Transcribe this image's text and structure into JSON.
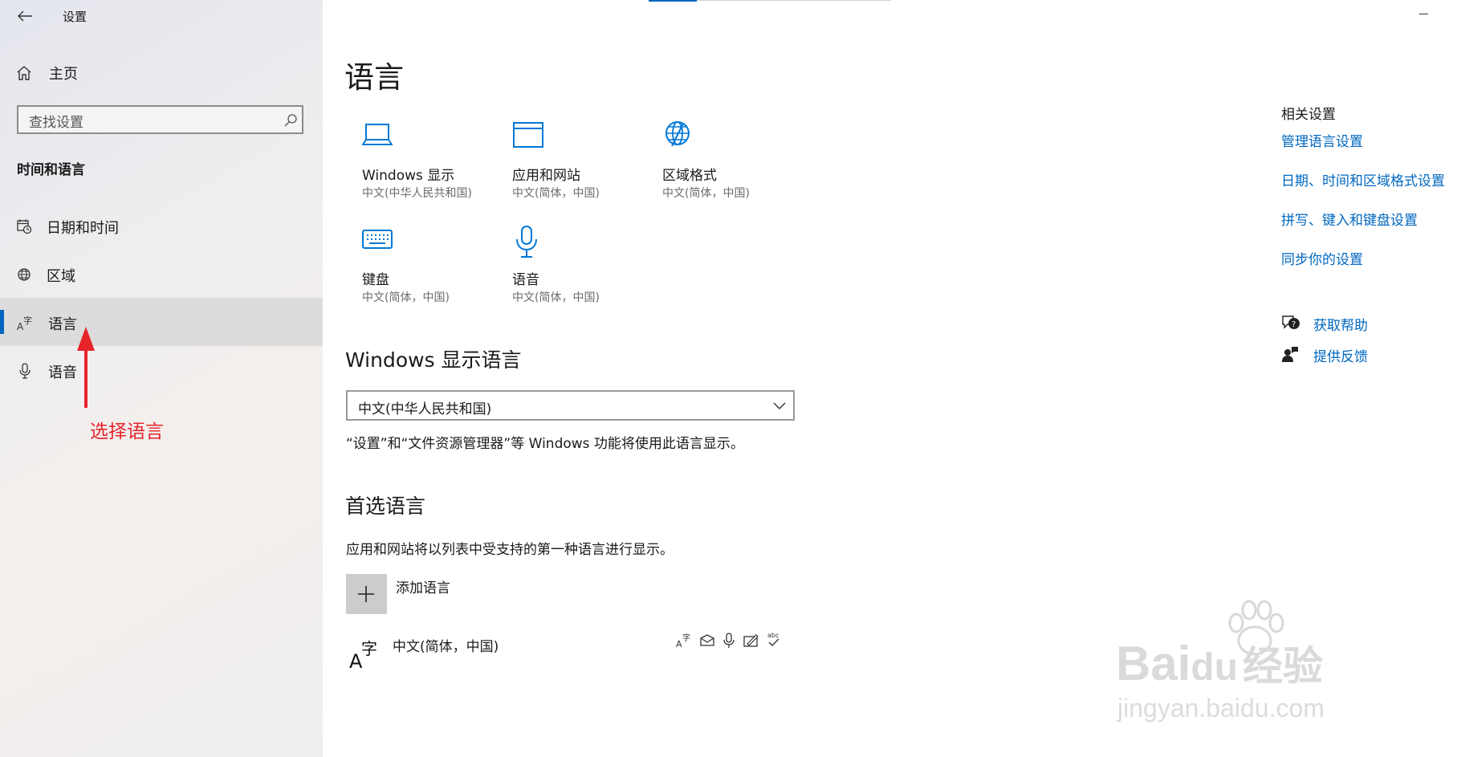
{
  "window": {
    "title": "设置"
  },
  "sidebar": {
    "home_label": "主页",
    "search_placeholder": "查找设置",
    "section_title": "时间和语言",
    "items": [
      {
        "label": "日期和时间",
        "icon": "calendar-clock-icon"
      },
      {
        "label": "区域",
        "icon": "globe-region-icon"
      },
      {
        "label": "语言",
        "icon": "language-icon",
        "selected": true
      },
      {
        "label": "语音",
        "icon": "microphone-icon"
      }
    ]
  },
  "annotation": {
    "text": "选择语言",
    "color": "#e8242b"
  },
  "main": {
    "title": "语言",
    "tiles": [
      {
        "title": "Windows 显示",
        "subtitle": "中文(中华人民共和国)",
        "icon": "laptop-icon"
      },
      {
        "title": "应用和网站",
        "subtitle": "中文(简体，中国)",
        "icon": "browser-window-icon"
      },
      {
        "title": "区域格式",
        "subtitle": "中文(简体，中国)",
        "icon": "globe-format-icon"
      },
      {
        "title": "键盘",
        "subtitle": "中文(简体，中国)",
        "icon": "keyboard-icon"
      },
      {
        "title": "语音",
        "subtitle": "中文(简体，中国)",
        "icon": "microphone-icon"
      }
    ],
    "display_language": {
      "heading": "Windows 显示语言",
      "selected": "中文(中华人民共和国)",
      "description": "“设置”和“文件资源管理器”等 Windows 功能将使用此语言显示。"
    },
    "preferred": {
      "heading": "首选语言",
      "description": "应用和网站将以列表中受支持的第一种语言进行显示。",
      "add_label": "添加语言",
      "languages": [
        {
          "name": "中文(简体，中国)",
          "feature_icons": [
            "display-language-icon",
            "text-to-speech-icon",
            "speech-recognition-icon",
            "handwriting-icon",
            "spellcheck-icon"
          ]
        }
      ]
    }
  },
  "related": {
    "title": "相关设置",
    "links": [
      "管理语言设置",
      "日期、时间和区域格式设置",
      "拼写、键入和键盘设置",
      "同步你的设置"
    ],
    "help": [
      {
        "label": "获取帮助",
        "icon": "help-chat-icon"
      },
      {
        "label": "提供反馈",
        "icon": "feedback-icon"
      }
    ]
  },
  "watermark": {
    "brand": "Bai",
    "brand2": "du",
    "cn": "经验",
    "url": "jingyan.baidu.com"
  },
  "colors": {
    "accent": "#0067c0",
    "annotation_red": "#e8242b"
  }
}
